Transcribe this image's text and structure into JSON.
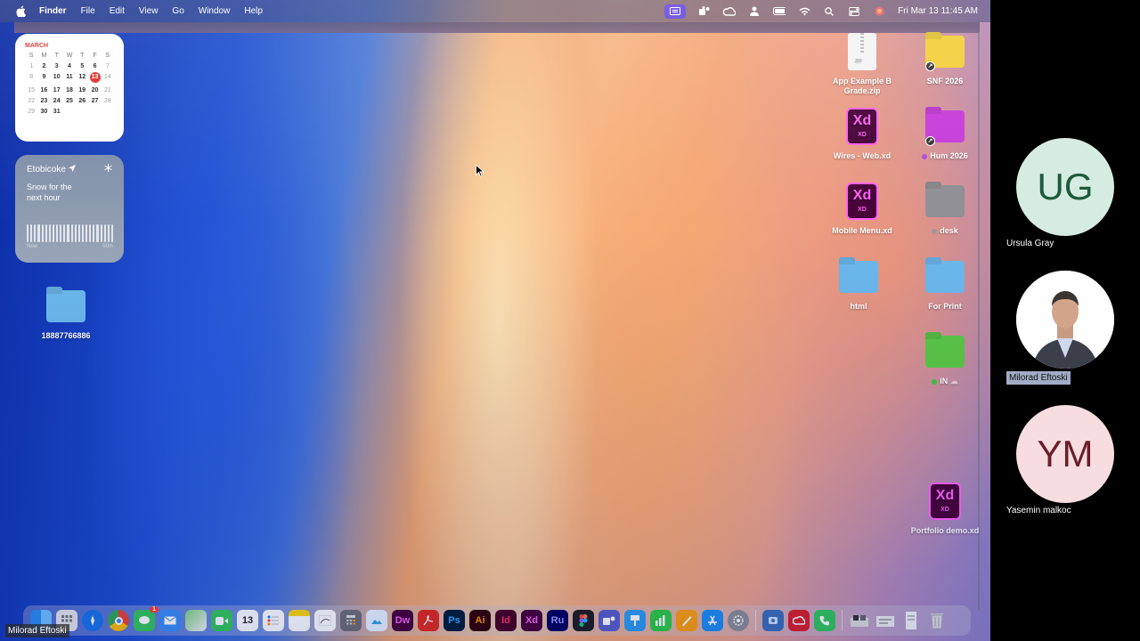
{
  "menubar": {
    "app": "Finder",
    "items": [
      "File",
      "Edit",
      "View",
      "Go",
      "Window",
      "Help"
    ],
    "status_icons": [
      "screen-share-icon",
      "teams-icon",
      "creative-cloud-icon",
      "user-icon",
      "battery-icon",
      "wifi-icon",
      "search-icon",
      "control-center-icon",
      "siri-icon"
    ],
    "clock": "Fri Mar 13  11:45 AM"
  },
  "calendar_widget": {
    "month": "MARCH",
    "weekdays": [
      "S",
      "M",
      "T",
      "W",
      "T",
      "F",
      "S"
    ],
    "today": "13",
    "weeks": [
      [
        "1",
        "2",
        "3",
        "4",
        "5",
        "6",
        "7"
      ],
      [
        "8",
        "9",
        "10",
        "11",
        "12",
        "13",
        "14"
      ],
      [
        "15",
        "16",
        "17",
        "18",
        "19",
        "20",
        "21"
      ],
      [
        "22",
        "23",
        "24",
        "25",
        "26",
        "27",
        "28"
      ],
      [
        "29",
        "30",
        "31",
        "",
        "",
        "",
        ""
      ]
    ]
  },
  "weather_widget": {
    "city": "Etobicoke",
    "description": "Snow for the next hour",
    "axis_start": "Now",
    "axis_end": "60m"
  },
  "desktop_icons": {
    "folder_left": "18887766886",
    "app_example": "App Example B Grade.zip",
    "snf": "SNF 2026",
    "wires": "Wires - Web.xd",
    "hum": "Hum 2026",
    "mobile": "Mobile Menu.xd",
    "desk": "desk",
    "html": "html",
    "for_print": "For Print",
    "in": "IN",
    "portfolio": "Portfolio demo.xd"
  },
  "icon_labels": {
    "xd_big": "Xd",
    "xd_small": "XD",
    "zip": "ZIP"
  },
  "colors": {
    "accent_red": "#e0322f",
    "xd_purple": "#ff61f6",
    "folder_blue": "#6cb8ec",
    "folder_yellow": "#f2cf3a",
    "folder_purple": "#c63bd8",
    "folder_gray": "#8f8f95",
    "folder_green": "#5cc744"
  },
  "dock": {
    "apps": [
      "Finder",
      "Launchpad",
      "Safari",
      "Chrome",
      "Messages",
      "Mail",
      "Maps",
      "FaceTime",
      "Calendar",
      "Reminders",
      "Notes",
      "Freeform",
      "Calculator",
      "Preview",
      "Dw",
      "Acrobat",
      "Ps",
      "Ai",
      "Id",
      "Xd",
      "Ru",
      "Figma",
      "Teams",
      "Keynote",
      "Numbers",
      "Pages",
      "App Store",
      "System Settings",
      "Screenshot",
      "Creative Cloud",
      "Phone",
      "Trash"
    ],
    "calendar_day": "13",
    "messages_badge": "1"
  },
  "video_name_tag": "Milorad Eftoski",
  "participants": [
    {
      "initials": "UG",
      "name": "Ursula Gray"
    },
    {
      "initials": "",
      "name": "Milorad Eftoski"
    },
    {
      "initials": "YM",
      "name": "Yasemin malkoc"
    }
  ]
}
